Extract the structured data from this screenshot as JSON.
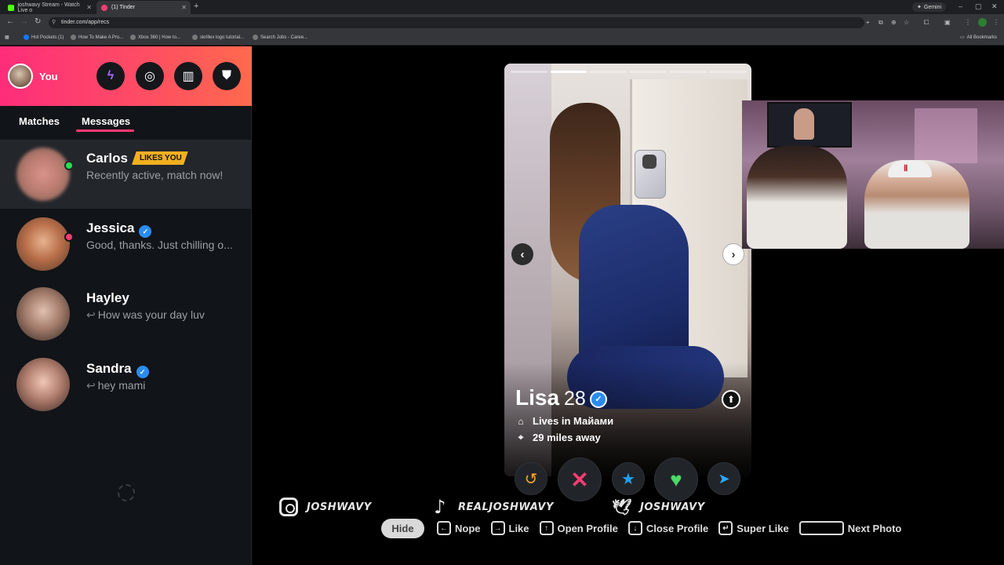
{
  "browser": {
    "tabs": [
      {
        "label": "joshwavy Stream - Watch Live o"
      },
      {
        "label": "(1) Tinder"
      }
    ],
    "new_tab": "+",
    "gemini": "Gemini",
    "url": "tinder.com/app/recs",
    "bookmarks": [
      "Hot Pockets (1)",
      "How To Make A Pro...",
      "Xbox 360 | How to...",
      "skrillex logo tutorial...",
      "Search Jobs - Caree..."
    ],
    "all_bookmarks": "All Bookmarks"
  },
  "sidebar": {
    "user_label": "You",
    "header_buttons": [
      {
        "icon": "lightning-icon",
        "glyph": "ϟ",
        "color": "#a76bff"
      },
      {
        "icon": "compass-icon",
        "glyph": "◎",
        "color": "#ffffff"
      },
      {
        "icon": "briefcase-icon",
        "glyph": "▥",
        "color": "#ffffff"
      },
      {
        "icon": "shield-icon",
        "glyph": "⛊",
        "color": "#ffffff"
      }
    ],
    "tabs": {
      "matches": "Matches",
      "messages": "Messages"
    },
    "conversations": [
      {
        "name": "Carlos",
        "badge": "LIKES YOU",
        "message": "Recently active, match now!"
      },
      {
        "name": "Jessica",
        "message": "Good, thanks. Just chilling o..."
      },
      {
        "name": "Hayley",
        "message": "How was your day luv"
      },
      {
        "name": "Sandra",
        "message": "hey mami"
      }
    ]
  },
  "card": {
    "photo_count": 6,
    "active_photo": 2,
    "name": "Lisa",
    "age": "28",
    "lives_in": "Lives in Майами",
    "distance": "29 miles away"
  },
  "actions": [
    "rewind-icon",
    "nope-icon",
    "super-like-icon",
    "like-icon",
    "boost-icon"
  ],
  "socials": [
    {
      "handle": "JOSHWAVY"
    },
    {
      "handle": "REALJOSHWAVY"
    },
    {
      "handle": "JOSHWAVY"
    }
  ],
  "hints": {
    "hide": "Hide",
    "nope": "Nope",
    "like": "Like",
    "open_profile": "Open Profile",
    "close_profile": "Close Profile",
    "super_like": "Super Like",
    "next_photo": "Next Photo"
  },
  "colors": {
    "brand_gradient_start": "#fd2d7a",
    "brand_gradient_end": "#ff6a4d",
    "likes_badge": "#f2b01f",
    "verified": "#2a8cf0"
  }
}
